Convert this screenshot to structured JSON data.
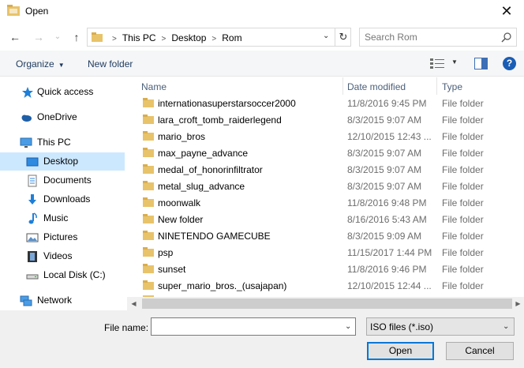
{
  "window": {
    "title": "Open",
    "close_glyph": "✕"
  },
  "nav_buttons": {
    "back": "←",
    "forward": "→",
    "up": "↑",
    "recent_caret": "⌄"
  },
  "address": {
    "crumbs": [
      "This PC",
      "Desktop",
      "Rom"
    ],
    "separator": ">",
    "refresh_glyph": "↻"
  },
  "search": {
    "placeholder": "Search Rom",
    "value": ""
  },
  "toolbar": {
    "organize_label": "Organize",
    "new_folder_label": "New folder",
    "help_label": "?"
  },
  "sidebar": {
    "items": [
      {
        "label": "Quick access",
        "icon": "star-icon"
      },
      {
        "label": "OneDrive",
        "icon": "cloud-icon"
      },
      {
        "label": "This PC",
        "icon": "computer-icon"
      },
      {
        "label": "Desktop",
        "icon": "desktop-icon",
        "selected": true
      },
      {
        "label": "Documents",
        "icon": "documents-icon"
      },
      {
        "label": "Downloads",
        "icon": "download-icon"
      },
      {
        "label": "Music",
        "icon": "music-icon"
      },
      {
        "label": "Pictures",
        "icon": "pictures-icon"
      },
      {
        "label": "Videos",
        "icon": "videos-icon"
      },
      {
        "label": "Local Disk (C:)",
        "icon": "drive-icon"
      },
      {
        "label": "Network",
        "icon": "network-icon"
      }
    ]
  },
  "columns": {
    "name": "Name",
    "date": "Date modified",
    "type": "Type"
  },
  "files": [
    {
      "name": "internationasuperstarsoccer2000",
      "date": "11/8/2016 9:45 PM",
      "type": "File folder"
    },
    {
      "name": "lara_croft_tomb_raiderlegend",
      "date": "8/3/2015 9:07 AM",
      "type": "File folder"
    },
    {
      "name": "mario_bros",
      "date": "12/10/2015 12:43 ...",
      "type": "File folder"
    },
    {
      "name": "max_payne_advance",
      "date": "8/3/2015 9:07 AM",
      "type": "File folder"
    },
    {
      "name": "medal_of_honorinfiltrator",
      "date": "8/3/2015 9:07 AM",
      "type": "File folder"
    },
    {
      "name": "metal_slug_advance",
      "date": "8/3/2015 9:07 AM",
      "type": "File folder"
    },
    {
      "name": "moonwalk",
      "date": "11/8/2016 9:48 PM",
      "type": "File folder"
    },
    {
      "name": "New folder",
      "date": "8/16/2016 5:43 AM",
      "type": "File folder"
    },
    {
      "name": "NINETENDO GAMECUBE",
      "date": "8/3/2015 9:09 AM",
      "type": "File folder"
    },
    {
      "name": "psp",
      "date": "11/15/2017 1:44 PM",
      "type": "File folder"
    },
    {
      "name": "sunset",
      "date": "11/8/2016 9:46 PM",
      "type": "File folder"
    },
    {
      "name": "super_mario_bros._(usajapan)",
      "date": "12/10/2015 12:44 ...",
      "type": "File folder"
    }
  ],
  "bottom": {
    "file_name_label": "File name:",
    "file_name_value": "",
    "filter_value": "ISO files (*.iso)",
    "open_label": "Open",
    "cancel_label": "Cancel"
  },
  "colors": {
    "folder": "#e8c36a",
    "accent": "#0078d7",
    "selection": "#cce8ff"
  }
}
